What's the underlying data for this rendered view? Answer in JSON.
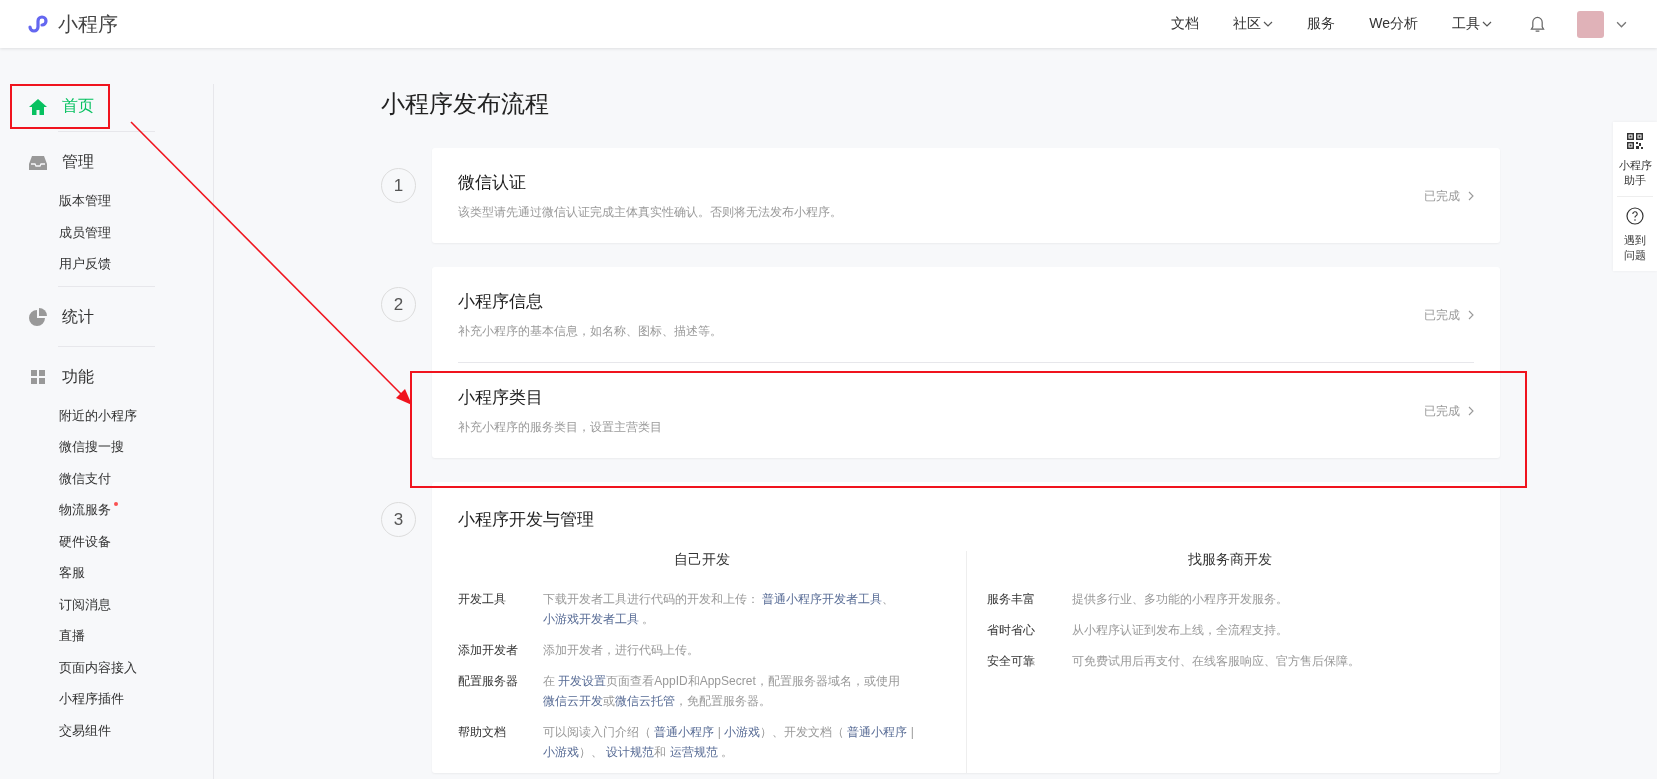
{
  "header": {
    "logo_text": "小程序",
    "nav": [
      {
        "label": "文档",
        "dropdown": false
      },
      {
        "label": "社区",
        "dropdown": true
      },
      {
        "label": "服务",
        "dropdown": false
      },
      {
        "label": "We分析",
        "dropdown": false
      },
      {
        "label": "工具",
        "dropdown": true
      }
    ]
  },
  "sidebar": {
    "sections": [
      {
        "label": "首页",
        "selected": true,
        "highlighted": true
      },
      {
        "label": "管理",
        "selected": false,
        "highlighted": false,
        "children": [
          {
            "label": "版本管理",
            "dot": false
          },
          {
            "label": "成员管理",
            "dot": false
          },
          {
            "label": "用户反馈",
            "dot": false
          }
        ]
      },
      {
        "label": "统计",
        "selected": false,
        "highlighted": false
      },
      {
        "label": "功能",
        "selected": false,
        "highlighted": false,
        "children": [
          {
            "label": "附近的小程序",
            "dot": false
          },
          {
            "label": "微信搜一搜",
            "dot": false
          },
          {
            "label": "微信支付",
            "dot": false
          },
          {
            "label": "物流服务",
            "dot": true
          },
          {
            "label": "硬件设备",
            "dot": false
          },
          {
            "label": "客服",
            "dot": false
          },
          {
            "label": "订阅消息",
            "dot": false
          },
          {
            "label": "直播",
            "dot": false
          },
          {
            "label": "页面内容接入",
            "dot": false
          },
          {
            "label": "小程序插件",
            "dot": false
          },
          {
            "label": "交易组件",
            "dot": false
          }
        ]
      }
    ]
  },
  "page_title": "小程序发布流程",
  "steps": [
    {
      "number": "1",
      "kind": "list",
      "items": [
        {
          "title": "微信认证",
          "description": "该类型请先通过微信认证完成主体真实性确认。否则将无法发布小程序。",
          "status": "已完成",
          "highlighted": false
        }
      ]
    },
    {
      "number": "2",
      "kind": "list",
      "items": [
        {
          "title": "小程序信息",
          "description": "补充小程序的基本信息，如名称、图标、描述等。",
          "status": "已完成",
          "highlighted": false
        },
        {
          "title": "小程序类目",
          "description": "补充小程序的服务类目，设置主营类目",
          "status": "已完成",
          "highlighted": true
        }
      ]
    },
    {
      "number": "3",
      "kind": "columns",
      "title": "小程序开发与管理",
      "columns": [
        {
          "heading": "自己开发",
          "rows": [
            {
              "label": "开发工具",
              "parts": [
                {
                  "text": "下载开发者工具进行代码的开发和上传： ",
                  "link": false
                },
                {
                  "text": "普通小程序开发者工具",
                  "link": true
                },
                {
                  "text": "、 ",
                  "link": false
                },
                {
                  "text": "小游戏开发者工具",
                  "link": true
                },
                {
                  "text": " 。",
                  "link": false
                }
              ]
            },
            {
              "label": "添加开发者",
              "parts": [
                {
                  "text": "添加开发者，进行代码上传。",
                  "link": false
                }
              ]
            },
            {
              "label": "配置服务器",
              "parts": [
                {
                  "text": "在 ",
                  "link": false
                },
                {
                  "text": "开发设置",
                  "link": true
                },
                {
                  "text": "页面查看AppID和AppSecret，配置服务器域名，或使用",
                  "link": false
                },
                {
                  "text": "微信云开发",
                  "link": true
                },
                {
                  "text": "或",
                  "link": false
                },
                {
                  "text": "微信云托管",
                  "link": true
                },
                {
                  "text": "，免配置服务器。",
                  "link": false
                }
              ]
            },
            {
              "label": "帮助文档",
              "parts": [
                {
                  "text": "可以阅读入门介绍（ ",
                  "link": false
                },
                {
                  "text": "普通小程序",
                  "link": true
                },
                {
                  "text": " | ",
                  "link": false
                },
                {
                  "text": "小游戏",
                  "link": true
                },
                {
                  "text": "）、开发文档（ ",
                  "link": false
                },
                {
                  "text": "普通小程序",
                  "link": true
                },
                {
                  "text": " | ",
                  "link": false
                },
                {
                  "text": "小游戏",
                  "link": true
                },
                {
                  "text": "）、 ",
                  "link": false
                },
                {
                  "text": "设计规范",
                  "link": true
                },
                {
                  "text": "和 ",
                  "link": false
                },
                {
                  "text": "运营规范",
                  "link": true
                },
                {
                  "text": " 。",
                  "link": false
                }
              ]
            }
          ]
        },
        {
          "heading": "找服务商开发",
          "rows": [
            {
              "label": "服务丰富",
              "parts": [
                {
                  "text": "提供多行业、多功能的小程序开发服务。",
                  "link": false
                }
              ]
            },
            {
              "label": "省时省心",
              "parts": [
                {
                  "text": "从小程序认证到发布上线，全流程支持。",
                  "link": false
                }
              ]
            },
            {
              "label": "安全可靠",
              "parts": [
                {
                  "text": "可免费试用后再支付、在线客服响应、官方售后保障。",
                  "link": false
                }
              ]
            }
          ]
        }
      ]
    }
  ],
  "side_tools": [
    {
      "lines": [
        "小程序",
        "助手"
      ]
    },
    {
      "lines": [
        "遇到",
        "问题"
      ]
    }
  ]
}
